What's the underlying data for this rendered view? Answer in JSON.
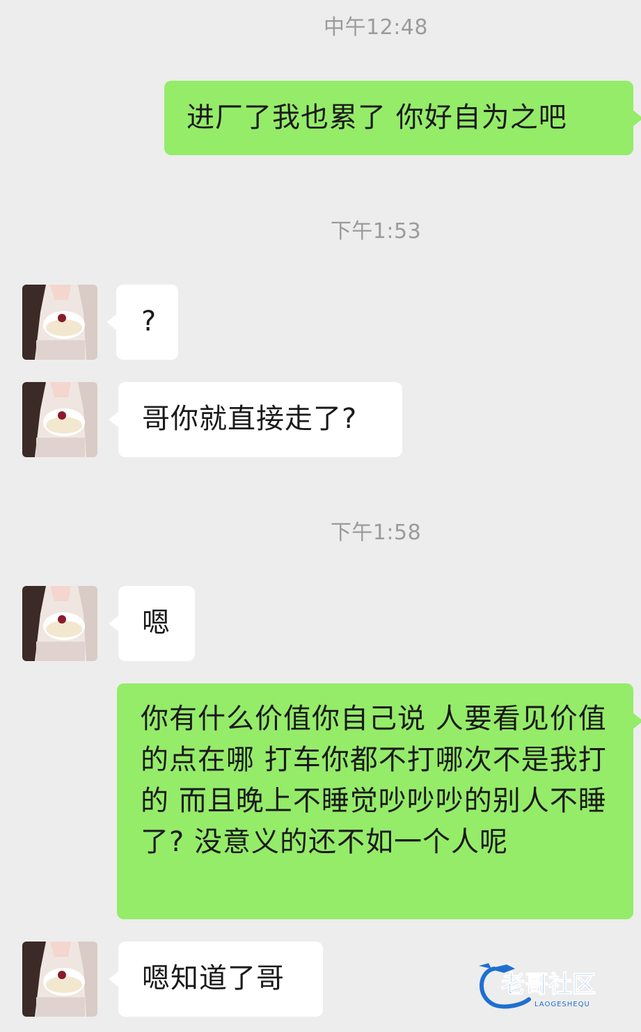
{
  "timestamps": [
    "中午12:48",
    "下午1:53",
    "下午1:58"
  ],
  "messages": [
    {
      "side": "out",
      "text": "进厂了我也累了 你好自为之吧"
    },
    {
      "side": "in",
      "text": "?"
    },
    {
      "side": "in",
      "text": "哥你就直接走了?"
    },
    {
      "side": "in",
      "text": "嗯"
    },
    {
      "side": "out",
      "text": "你有什么价值你自己说 人要看见价值的点在哪 打车你都不打哪次不是我打的  而且晚上不睡觉吵吵吵的别人不睡了?  没意义的还不如一个人呢"
    },
    {
      "side": "in",
      "text": "嗯知道了哥"
    }
  ],
  "watermark": {
    "title": "老哥社区",
    "subtitle": "LAOGESHEQU"
  },
  "colors": {
    "background": "#ededed",
    "outgoing_bubble": "#95ec69",
    "incoming_bubble": "#ffffff",
    "timestamp_text": "#9b9b9b",
    "watermark_blue": "#1f6fd1"
  },
  "icons": {
    "avatar": "avatar-photo",
    "watermark": "dragon-logo"
  }
}
